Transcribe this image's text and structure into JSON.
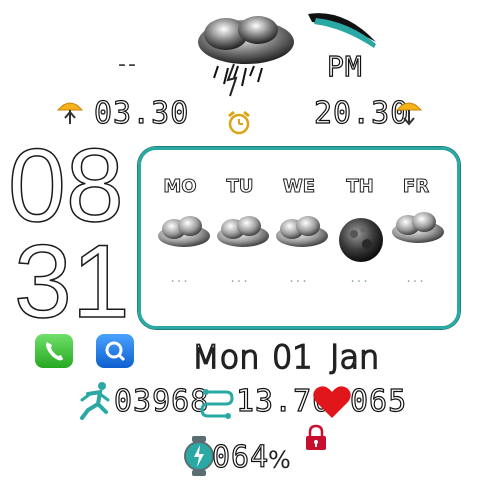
{
  "header": {
    "top_left_indicator": "--",
    "ampm": "PM",
    "weather_icon": "storm-cloud-icon"
  },
  "sun": {
    "sunrise": "03.30",
    "sunset": "20.30",
    "sunrise_icon": "sunrise-umbrella-icon",
    "sunset_icon": "sunset-umbrella-icon",
    "alarm_icon": "alarm-clock-icon"
  },
  "time": {
    "hours": "08",
    "minutes": "31"
  },
  "forecast": {
    "days": [
      {
        "label": "MO",
        "icon": "cloud-icon",
        "value": "..."
      },
      {
        "label": "TU",
        "icon": "cloud-icon",
        "value": "..."
      },
      {
        "label": "WE",
        "icon": "cloud-icon",
        "value": "..."
      },
      {
        "label": "TH",
        "icon": "moon-icon",
        "value": "..."
      },
      {
        "label": "FR",
        "icon": "cloud-icon",
        "value": "..."
      }
    ],
    "border_color": "#2aa9a4"
  },
  "shortcuts": {
    "phone_icon": "phone-icon",
    "search_icon": "search-icon"
  },
  "date": {
    "weekday": "Mon",
    "day": "01",
    "month": "Jan"
  },
  "stats": {
    "steps": "03968",
    "distance": "13.70",
    "heart_rate": "065",
    "battery": "064",
    "battery_unit": "%"
  },
  "colors": {
    "accent": "#2aa9a4",
    "heart": "#e0161b",
    "lock": "#c8102e",
    "phone": "#3fc43b",
    "search": "#1e7be6"
  }
}
